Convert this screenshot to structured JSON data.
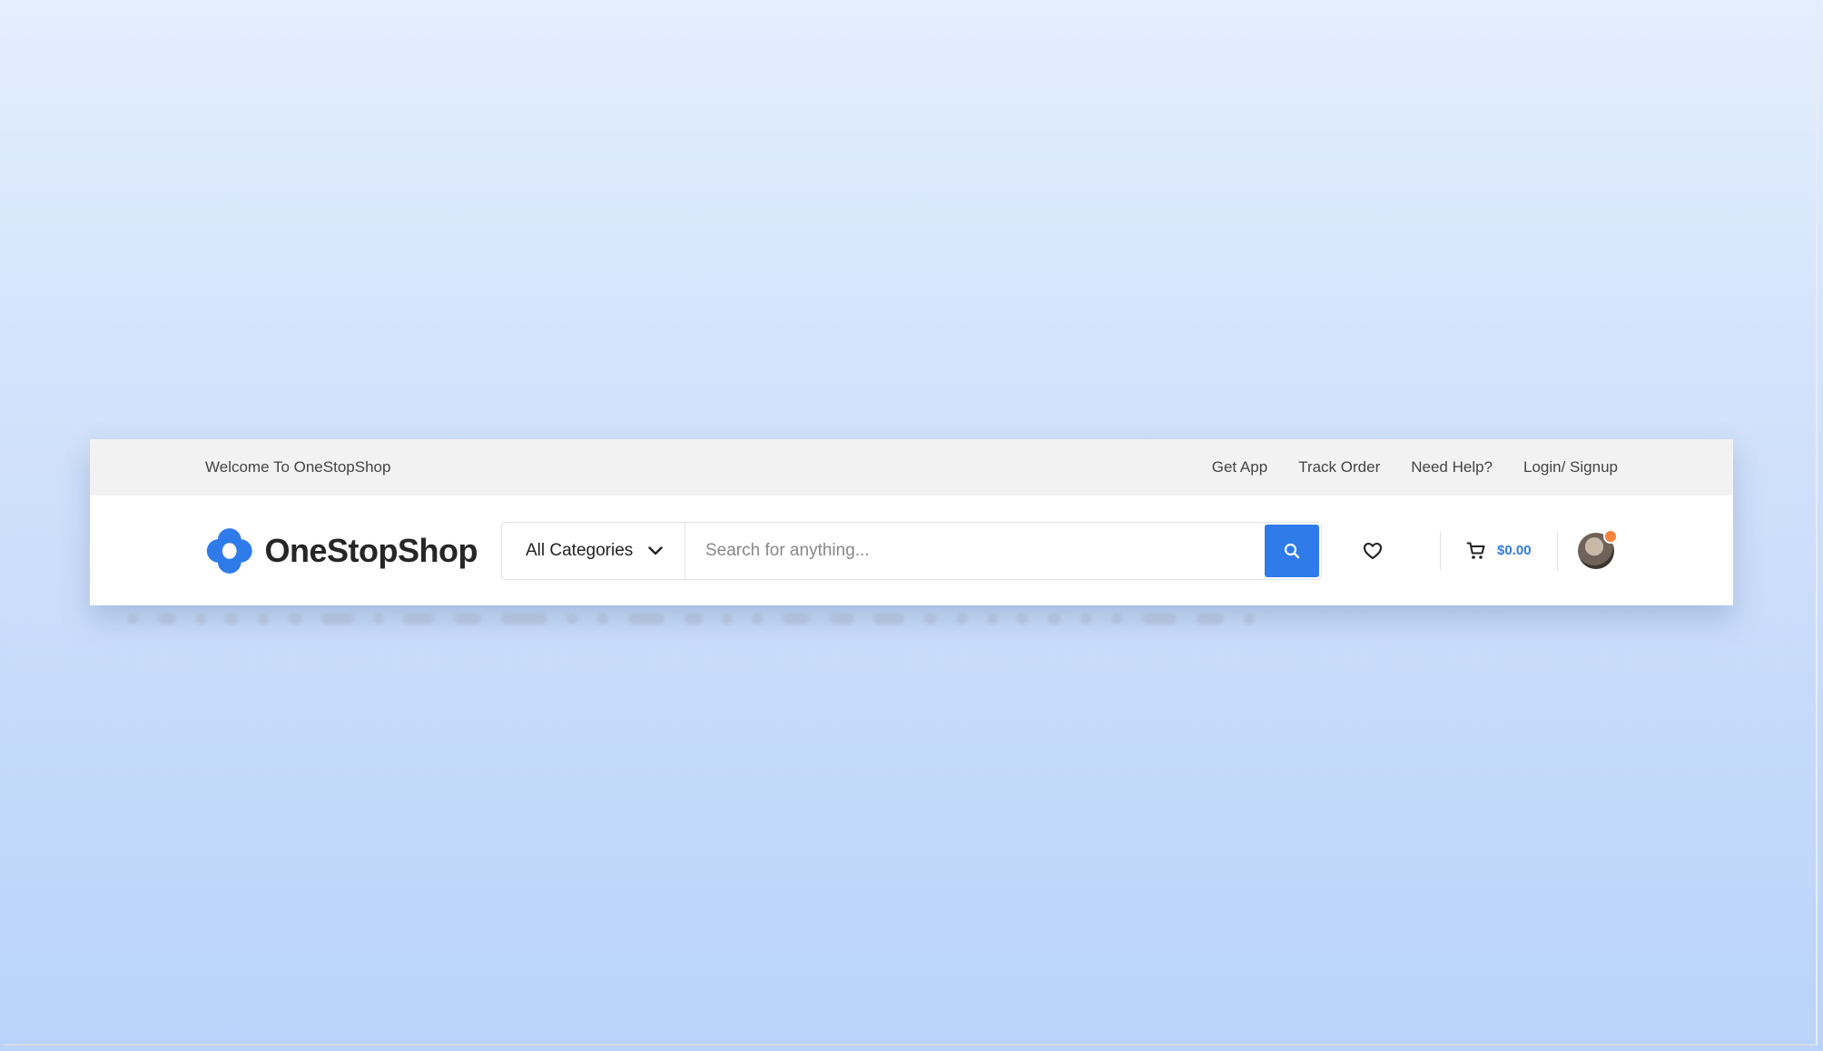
{
  "topbar": {
    "welcome": "Welcome To OneStopShop",
    "links": [
      {
        "label": "Get App"
      },
      {
        "label": "Track Order"
      },
      {
        "label": "Need Help?"
      },
      {
        "label": "Login/ Signup"
      }
    ]
  },
  "brand": {
    "name": "OneStopShop",
    "logo_icon": "flower-logo-icon",
    "logo_color": "#2f7be9"
  },
  "search": {
    "category": "All Categories",
    "placeholder": "Search for anything...",
    "button_icon": "search-icon",
    "button_color": "#2f7be9"
  },
  "actions": {
    "wishlist_icon": "heart-icon",
    "cart_icon": "cart-icon",
    "cart_amount": "$0.00",
    "notification_color": "#f5833b"
  }
}
